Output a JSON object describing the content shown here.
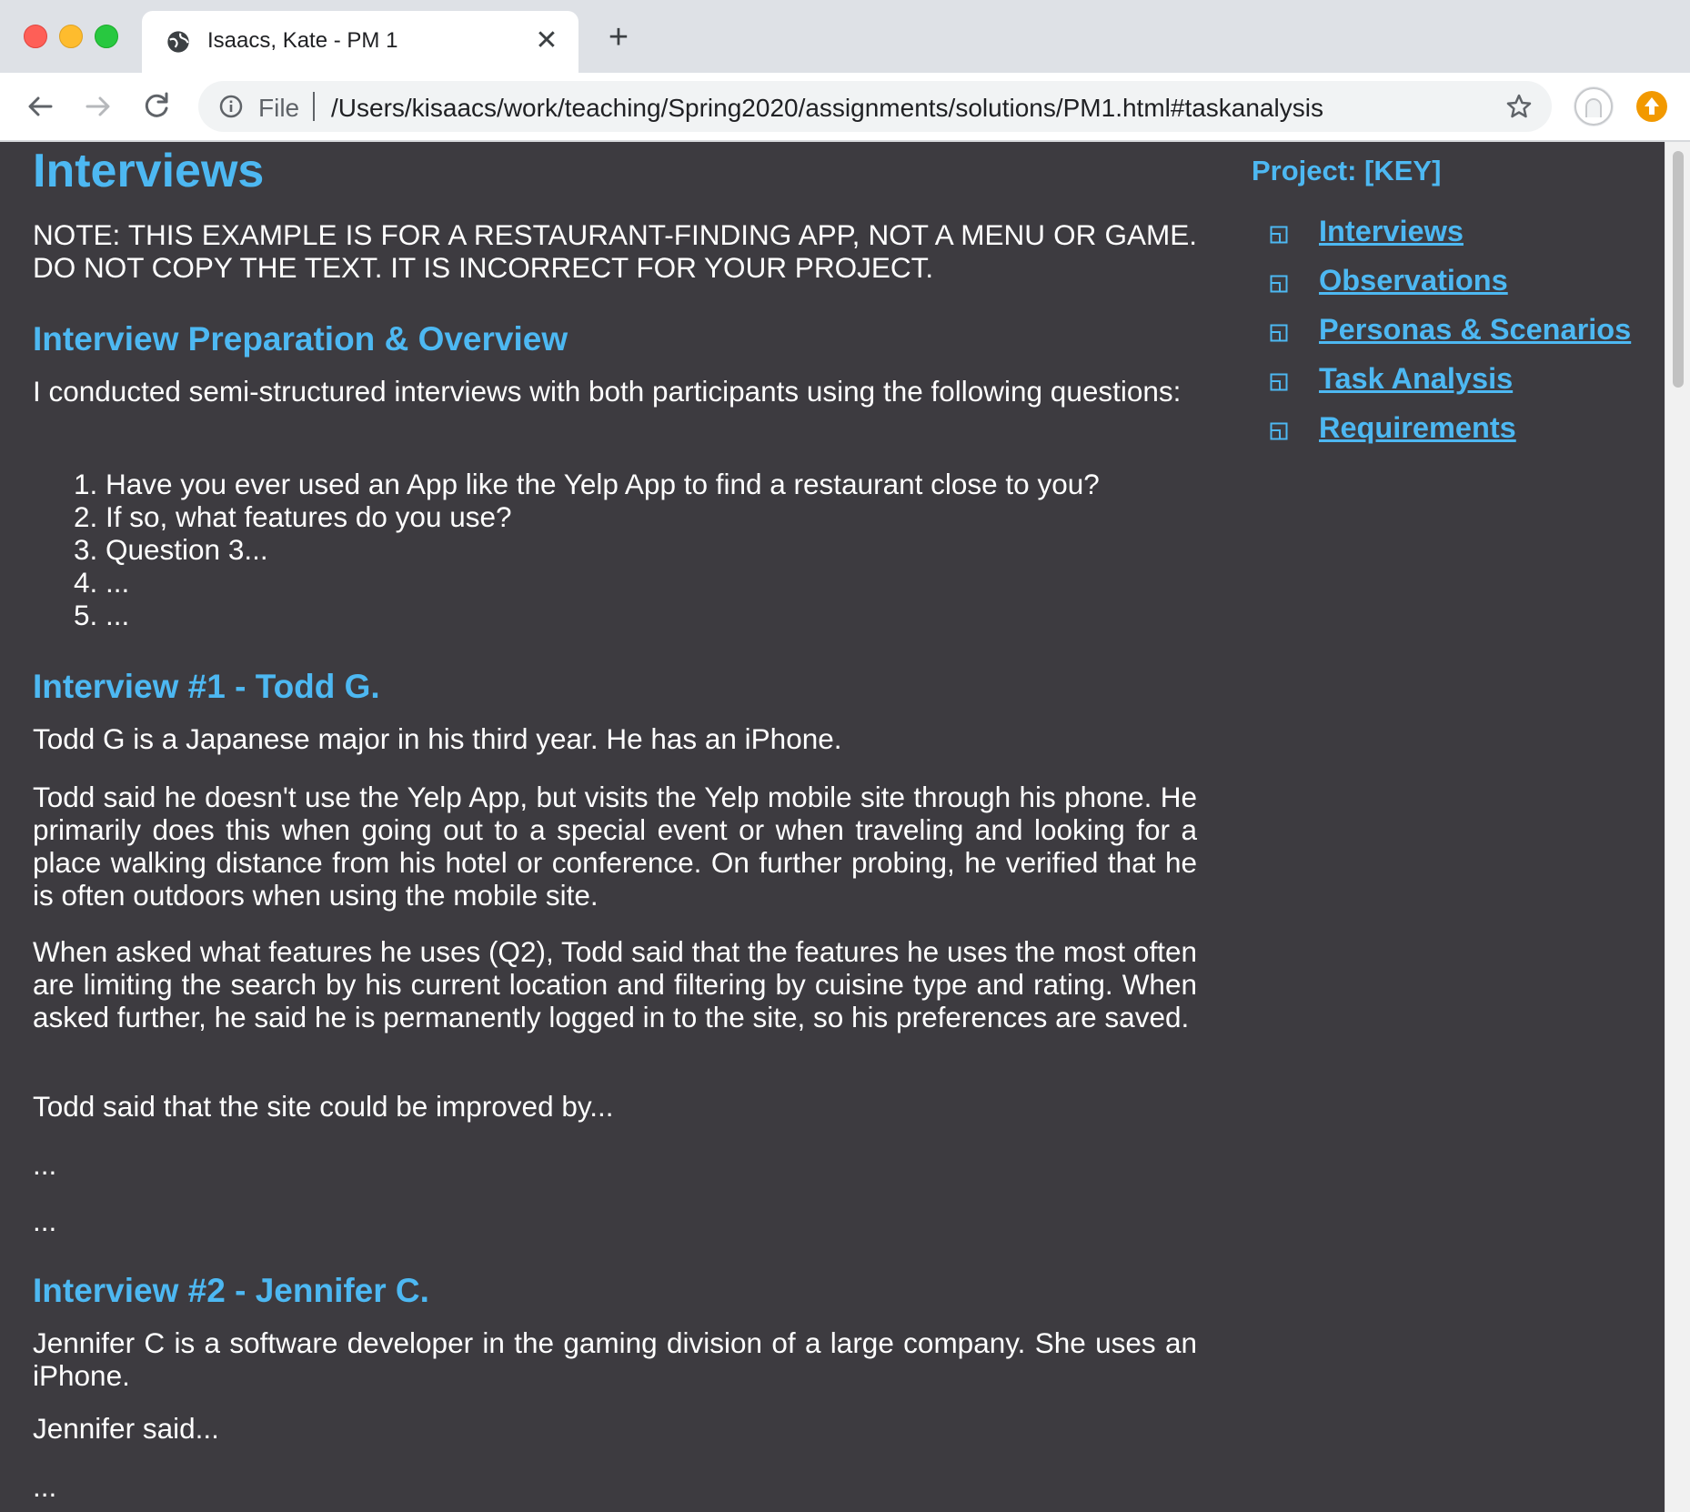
{
  "browser": {
    "tab_title": "Isaacs, Kate - PM 1",
    "url_scheme": "File",
    "url": "/Users/kisaacs/work/teaching/Spring2020/assignments/solutions/PM1.html#taskanalysis",
    "new_tab_label": "+",
    "close_tab_label": "✕"
  },
  "content": {
    "title": "Interviews",
    "note": "NOTE: THIS EXAMPLE IS FOR A RESTAURANT-FINDING APP, NOT A MENU OR GAME. DO NOT COPY THE TEXT. IT IS INCORRECT FOR YOUR PROJECT.",
    "prep_heading": "Interview Preparation & Overview",
    "prep_text": "I conducted semi-structured interviews with both participants using the following questions:",
    "questions": [
      "Have you ever used an App like the Yelp App to find a restaurant close to you?",
      "If so, what features do you use?",
      "Question 3...",
      "...",
      "..."
    ],
    "interview1_heading": "Interview #1 - Todd G.",
    "interview1_p1": "Todd G is a Japanese major in his third year. He has an iPhone.",
    "interview1_p2": "Todd said he doesn't use the Yelp App, but visits the Yelp mobile site through his phone. He primarily does this when going out to a special event or when traveling and looking for a place walking distance from his hotel or conference. On further probing, he verified that he is often outdoors when using the mobile site.",
    "interview1_p3": "When asked what features he uses (Q2), Todd said that the features he uses the most often are limiting the search by his current location and filtering by cuisine type and rating. When asked further, he said he is permanently logged in to the site, so his preferences are saved.",
    "interview1_p4": "Todd said that the site could be improved by...",
    "ellipsis1": "...",
    "ellipsis2": "...",
    "interview2_heading": "Interview #2 - Jennifer C.",
    "interview2_p1": "Jennifer C is a software developer in the gaming division of a large company. She uses an iPhone.",
    "interview2_p2": "Jennifer said...",
    "ellipsis3": "..."
  },
  "sidebar": {
    "project_title": "Project: [KEY]",
    "items": [
      {
        "label": "Interviews"
      },
      {
        "label": "Observations"
      },
      {
        "label": "Personas & Scenarios"
      },
      {
        "label": "Task Analysis"
      },
      {
        "label": "Requirements"
      }
    ]
  },
  "colors": {
    "page_background": "#3d3b40",
    "heading": "#4db8f2",
    "text": "#ffffff"
  }
}
